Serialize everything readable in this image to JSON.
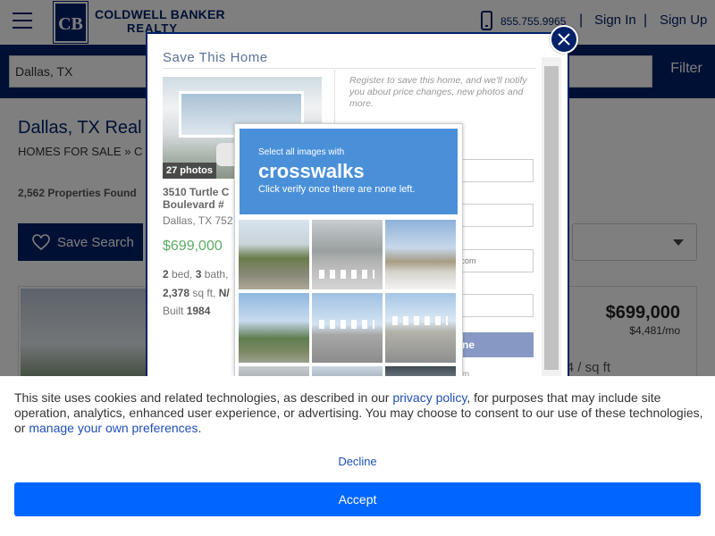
{
  "header": {
    "logo_mark": "CB",
    "logo_line1": "COLDWELL BANKER",
    "logo_line2": "REALTY",
    "phone": "855.755.9965",
    "separator": "|",
    "sign_in": "Sign In",
    "sign_up": "Sign Up"
  },
  "search": {
    "value": "Dallas, TX",
    "filter_label": "Filter"
  },
  "page": {
    "title": "Dallas, TX Real E",
    "breadcrumb": "HOMES FOR SALE  »  C",
    "count": "2,562 Properties Found",
    "save_search_label": "Save Search"
  },
  "listing": {
    "price": "$699,000",
    "monthly": "$4,481/mo",
    "sqft_partial": "4 / sq ft"
  },
  "modal": {
    "title": "Save This Home",
    "photo_count": "27 photos",
    "address_line1": "3510 Turtle C",
    "address_line2": "Boulevard #",
    "city": "Dallas, TX 752",
    "price": "$699,000",
    "beds_num": "2",
    "beds_text": " bed, ",
    "bath_num": "3",
    "bath_text": " bath,",
    "sqft_num": "2,378",
    "sqft_text": " sq ft, ",
    "sqft_suffix": "N/",
    "built_label": "Built ",
    "built_year": "1984",
    "register_text": "Register to save this home, and we'll notify you about price changes, new photos and more.",
    "email_placeholder": "ail.com",
    "submit_partial": "ne",
    "fine_print": "orm"
  },
  "captcha": {
    "instruction_small": "Select all images with",
    "target": "crosswalks",
    "instruction_sub": "Click verify once there are none left."
  },
  "cookie": {
    "text_before": "This site uses cookies and related technologies, as described in our ",
    "privacy_link": "privacy policy",
    "text_middle": ", for purposes that may include site operation, analytics, enhanced user experience, or advertising. You may choose to consent to our use of these technologies, or ",
    "prefs_link": "manage your own preferences",
    "text_end": ".",
    "decline": "Decline",
    "accept": "Accept"
  },
  "colors": {
    "brand_navy": "#012169",
    "price_green": "#5cab63",
    "captcha_blue": "#4a90d9",
    "accept_blue": "#0066ff"
  }
}
